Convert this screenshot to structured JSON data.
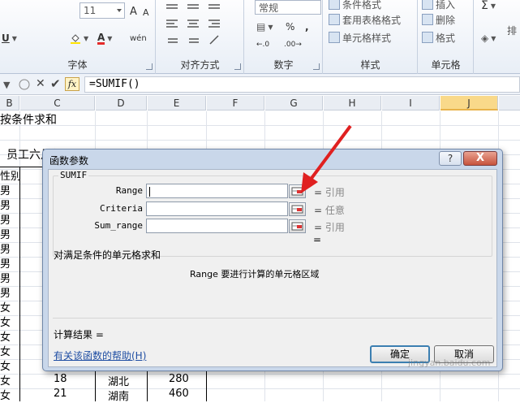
{
  "ribbon": {
    "font_size_value": "11",
    "number_format_value": "常规",
    "groups": {
      "font": "字体",
      "alignment": "对齐方式",
      "number": "数字",
      "styles": "样式",
      "cells": "单元格"
    },
    "styles_items": [
      "条件格式",
      "套用表格格式",
      "单元格样式"
    ],
    "cells_items": [
      "插入",
      "删除",
      "格式"
    ],
    "edit_item": "排"
  },
  "formula_bar": {
    "formula": "=SUMIF()"
  },
  "columns": [
    "B",
    "C",
    "D",
    "E",
    "F",
    "G",
    "H",
    "I",
    "J"
  ],
  "sheet": {
    "title_cell": "按条件求和",
    "table_heading": "员工六月份",
    "header_col_b": "性别",
    "col_b_values": [
      "男",
      "男",
      "男",
      "男",
      "男",
      "男",
      "男",
      "男",
      "女",
      "女",
      "女",
      "女",
      "女",
      "女",
      "女"
    ],
    "visible_rows": [
      {
        "age": "18",
        "region": "湖北",
        "amount": "280"
      },
      {
        "age": "21",
        "region": "湖南",
        "amount": "460"
      }
    ]
  },
  "dialog": {
    "title": "函数参数",
    "help_button": "?",
    "close_button": "X",
    "function_name": "SUMIF",
    "args": [
      {
        "label": "Range",
        "value": "",
        "hint": "引用"
      },
      {
        "label": "Criteria",
        "value": "",
        "hint": "任意"
      },
      {
        "label": "Sum_range",
        "value": "",
        "hint": "引用"
      }
    ],
    "equals_sign": "=",
    "result_equals": "=",
    "description": "对满足条件的单元格求和",
    "arg_description": "Range  要进行计算的单元格区域",
    "result_label": "计算结果 =",
    "help_link": "有关该函数的帮助(H)",
    "ok_button": "确定",
    "cancel_button": "取消"
  },
  "watermark": "jingyan.baidu.com",
  "colors": {
    "annotation_arrow": "#e02020",
    "selected_column": "#f9d98a",
    "dialog_frame": "#c9d7ea"
  },
  "icons": [
    "underline-icon",
    "fill-color-icon",
    "font-color-icon",
    "phonetic-icon",
    "align-icon",
    "percent-icon",
    "comma-icon",
    "decimal-icon",
    "cancel-icon",
    "enter-icon",
    "fx-icon",
    "range-ref-icon",
    "sum-icon",
    "eraser-icon"
  ]
}
